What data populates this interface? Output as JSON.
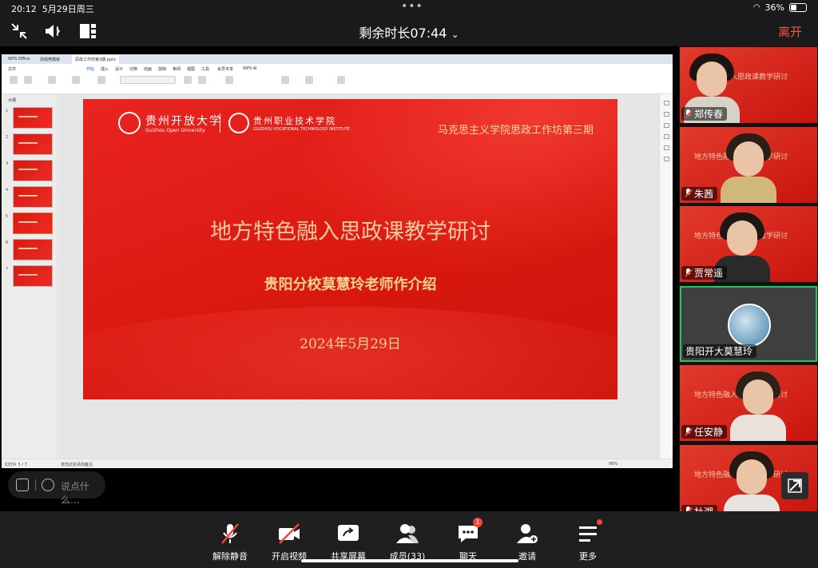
{
  "status": {
    "time": "20:12",
    "date": "5月29日周三",
    "battery": "36%",
    "battery_level": 0.36
  },
  "topbar": {
    "title": "剩余时长07:44",
    "leave_label": "离开"
  },
  "wps": {
    "tabs": [
      "WPS Office",
      "找稻壳模板",
      "思政工作坊第3期.pptx"
    ],
    "menus": [
      "文件",
      "开始",
      "插入",
      "设计",
      "切换",
      "动画",
      "放映",
      "审阅",
      "视图",
      "工具",
      "会员专享",
      "WPS AI"
    ],
    "panel_label": "大纲",
    "slide_count": 7,
    "status_left": "幻灯片 5 / 7",
    "status_notes": "单击此处添加备注",
    "zoom": "99%"
  },
  "slide": {
    "org1": "贵州开放大学",
    "org1_en": "Guizhou Open University",
    "org2": "贵州职业技术学院",
    "org2_en": "GUIZHOU VOCATIONAL TECHNOLOGY INSTITUTE",
    "series": "马克思主义学院思政工作坊第三期",
    "title": "地方特色融入思政课教学研讨",
    "subtitle": "贵阳分校莫慧玲老师作介绍",
    "date": "2024年5月29日"
  },
  "chat": {
    "placeholder": "说点什么..."
  },
  "participants": [
    {
      "name": "郑传春",
      "muted": true,
      "slide_text": "地方特色融入思政课教学研讨"
    },
    {
      "name": "朱茜",
      "muted": true,
      "slide_text": "地方特色融入思政课教学研讨"
    },
    {
      "name": "贾常遥",
      "muted": true,
      "slide_text": "地方特色融入思政课教学研讨"
    },
    {
      "name": "贵阳开大莫慧玲",
      "muted": false,
      "active": true
    },
    {
      "name": "任安静",
      "muted": true,
      "slide_text": "地方特色融入思政课教学研讨"
    },
    {
      "name": "杜溯",
      "muted": true,
      "slide_text": "地方特色融入思政课教学研讨"
    }
  ],
  "toolbar": {
    "unmute": "解除静音",
    "video": "开启视频",
    "share": "共享屏幕",
    "members": "成员(33)",
    "chat": "聊天",
    "chat_badge": "1",
    "invite": "邀请",
    "more": "更多"
  },
  "colors": {
    "accent_red": "#f2554d",
    "active_border": "#22c55e",
    "slide_red": "#d9180f"
  }
}
